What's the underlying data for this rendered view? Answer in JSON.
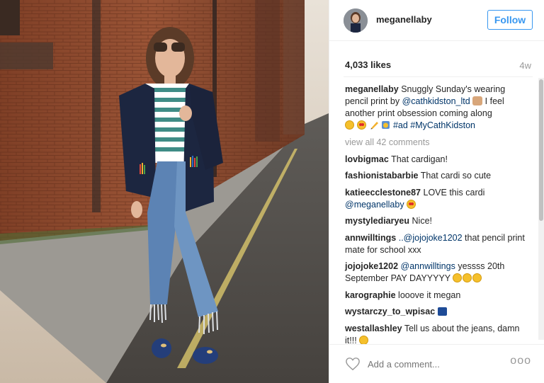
{
  "post": {
    "username": "meganellaby",
    "follow_label": "Follow",
    "likes": "4,033 likes",
    "age": "4w",
    "caption": {
      "username": "meganellaby",
      "text_1": "Snuggly Sunday's wearing pencil print by",
      "mention": "@cathkidston_ltd",
      "text_2": "I feel another print obsession coming along",
      "tags": "#ad #MyCathKidston"
    },
    "view_all": "view all 42 comments",
    "comments": [
      {
        "user": "lovbigmac",
        "text": "That cardigan!"
      },
      {
        "user": "fashionistabarbie",
        "text": "That cardi so cute"
      },
      {
        "user": "katieecclestone87",
        "text": "LOVE this cardi",
        "mention": "@meganellaby"
      },
      {
        "user": "mystylediaryeu",
        "text": "Nice!"
      },
      {
        "user": "annwilltings",
        "pre": "..",
        "mention": "@jojojoke1202",
        "text": "that pencil print mate for school xxx"
      },
      {
        "user": "jojojoke1202",
        "mention": "@annwilltings",
        "text": "yessss 20th September PAY DAYYYYY"
      },
      {
        "user": "karographie",
        "text": "looove it megan"
      },
      {
        "user": "wystarczy_to_wpisac",
        "text": ""
      },
      {
        "user": "westallashley",
        "text": "Tell us about the jeans, damn it!!!"
      }
    ],
    "add_comment_placeholder": "Add a comment...",
    "more_label": "ooo"
  },
  "icons": {
    "heart": "heart-outline-icon",
    "more": "more-options-icon"
  },
  "colors": {
    "link": "#003569",
    "follow": "#3897f0",
    "muted": "#999999"
  }
}
